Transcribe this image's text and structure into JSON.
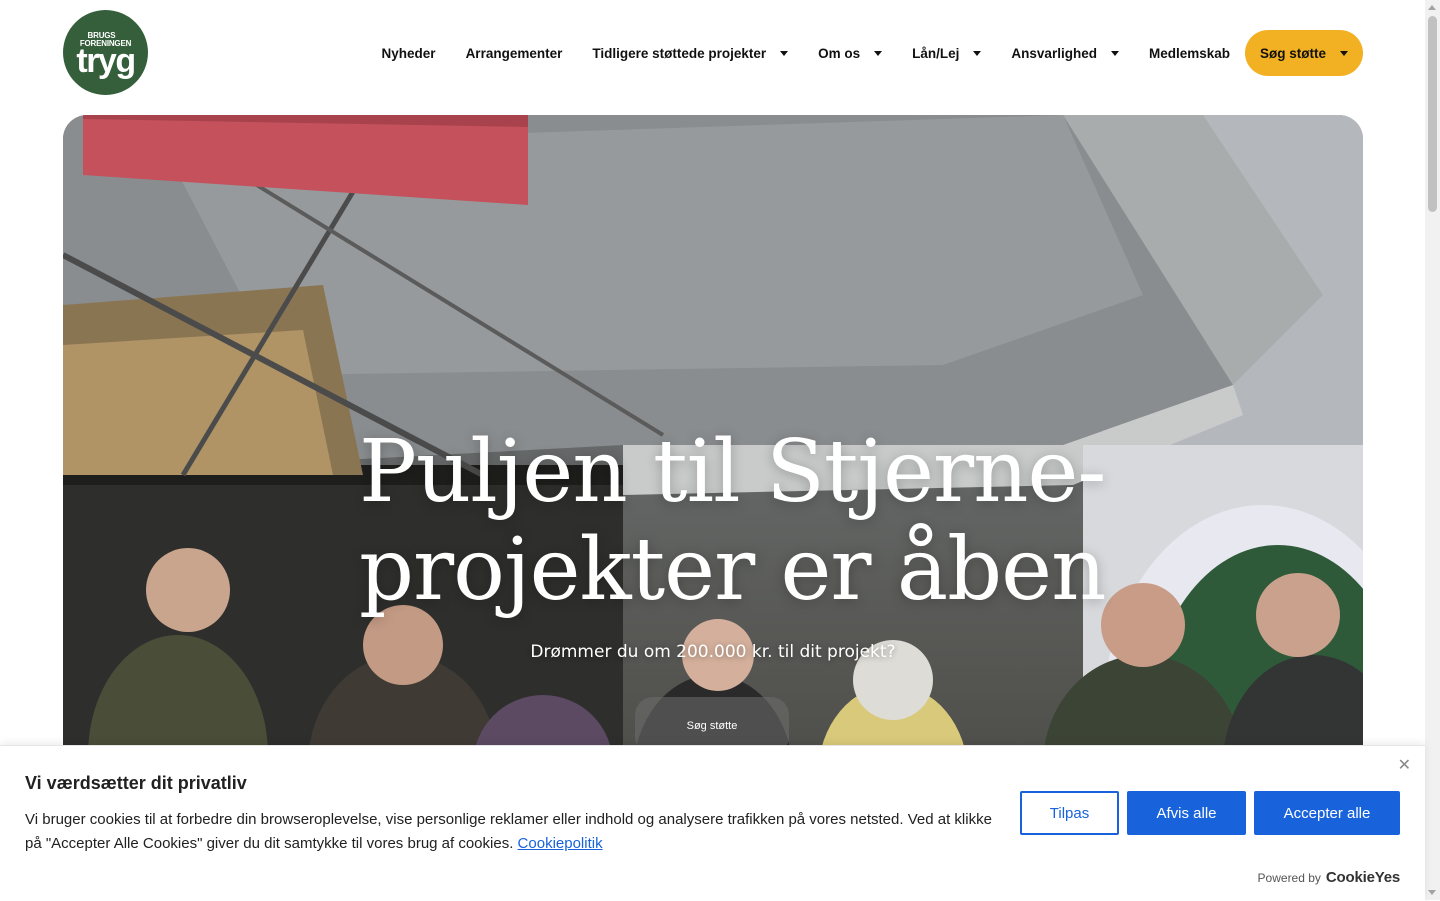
{
  "logo": {
    "small_line1": "BRUGS",
    "small_line2": "FORENINGEN",
    "brand": "tryg"
  },
  "nav": {
    "items": [
      {
        "label": "Nyheder",
        "dropdown": false
      },
      {
        "label": "Arrangementer",
        "dropdown": false
      },
      {
        "label": "Tidligere støttede projekter",
        "dropdown": true
      },
      {
        "label": "Om os",
        "dropdown": true
      },
      {
        "label": "Lån/Lej",
        "dropdown": true
      },
      {
        "label": "Ansvarlighed",
        "dropdown": true
      },
      {
        "label": "Medlemskab",
        "dropdown": false
      }
    ],
    "cta_label": "Søg støtte"
  },
  "hero": {
    "title_line1": "Puljen til Stjerne-",
    "title_line2": "projekter er åben",
    "subtitle": "Drømmer du om 200.000 kr. til dit projekt?",
    "button_label": "Søg støtte"
  },
  "cookie_banner": {
    "title": "Vi værdsætter dit privatliv",
    "text": "Vi bruger cookies til at forbedre din browseroplevelse, vise personlige reklamer eller indhold og analysere trafikken på vores netsted. Ved at klikke på \"Accepter Alle Cookies\" giver du dit samtykke til vores brug af cookies.",
    "policy_link": "Cookiepolitik",
    "customize_label": "Tilpas",
    "reject_label": "Afvis alle",
    "accept_label": "Accepter alle",
    "powered_by": "Powered by",
    "powered_brand": "CookieYes",
    "close_glyph": "✕"
  },
  "colors": {
    "brand_green": "#355f3b",
    "cta_yellow": "#f2b122",
    "cookie_blue": "#1863dc"
  }
}
